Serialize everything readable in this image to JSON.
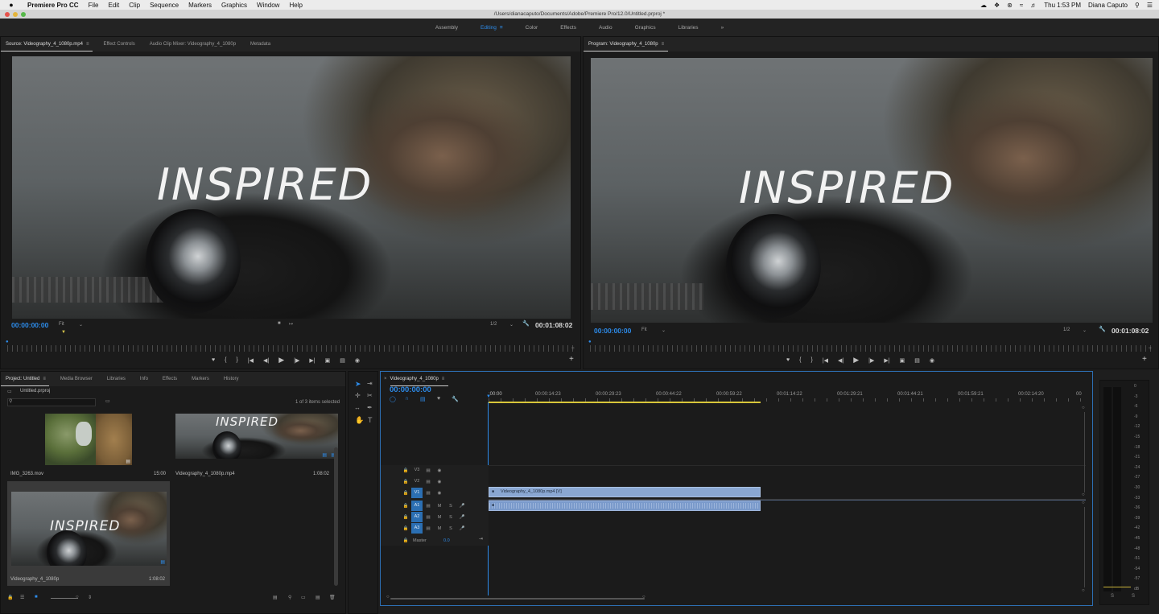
{
  "menubar": {
    "apple": "",
    "items": [
      "Premiere Pro CC",
      "File",
      "Edit",
      "Clip",
      "Sequence",
      "Markers",
      "Graphics",
      "Window",
      "Help"
    ],
    "clock": "Thu 1:53 PM",
    "user": "Diana Caputo"
  },
  "titlebar": {
    "path": "/Users/dianacaputo/Documents/Adobe/Premiere Pro/12.0/Untitled.prproj *"
  },
  "workspaces": {
    "items": [
      "Assembly",
      "Editing",
      "Color",
      "Effects",
      "Audio",
      "Graphics",
      "Libraries"
    ],
    "more": "»"
  },
  "source": {
    "tabs": [
      "Source: Videography_4_1080p.mp4",
      "Effect Controls",
      "Audio Clip Mixer: Videography_4_1080p",
      "Metadata"
    ],
    "overlay": "INSPIRED",
    "timecode": "00:00:00:00",
    "fit": "Fit",
    "resolution": "1/2",
    "duration": "00:01:08:02"
  },
  "program": {
    "tab": "Program: Videography_4_1080p",
    "overlay": "INSPIRED",
    "timecode": "00:00:00:00",
    "fit": "Fit",
    "resolution": "1/2",
    "duration": "00:01:08:02"
  },
  "project": {
    "tabs": [
      "Project: Untitled",
      "Media Browser",
      "Libraries",
      "Info",
      "Effects",
      "Markers",
      "History"
    ],
    "file": "Untitled.prproj",
    "selection": "1 of 3 items selected",
    "items": [
      {
        "name": "IMG_3263.mov",
        "duration": "15:00"
      },
      {
        "name": "Videography_4_1080p.mp4",
        "duration": "1:08:02",
        "overlay": "INSPIRED"
      },
      {
        "name": "Videography_4_1080p",
        "duration": "1:08:02",
        "overlay": "INSPIRED"
      }
    ]
  },
  "timeline": {
    "tab": "Videography_4_1080p",
    "timecode": "00:00:00:00",
    "ruler": [
      ":00:00",
      "00:00:14:23",
      "00:00:29:23",
      "00:00:44:22",
      "00:00:59:22",
      "00:01:14:22",
      "00:01:29:21",
      "00:01:44:21",
      "00:01:59:21",
      "00:02:14:20",
      "00"
    ],
    "video_tracks": [
      "V3",
      "V2",
      "V1"
    ],
    "audio_tracks": [
      "A1",
      "A2",
      "A3"
    ],
    "track_buttons": {
      "mute": "M",
      "solo": "S"
    },
    "master": {
      "label": "Master",
      "value": "0.0"
    },
    "clip_name": "Videography_4_1080p.mp4 [V]"
  },
  "meter": {
    "scale": [
      "0",
      "-3",
      "-6",
      "-9",
      "-12",
      "-15",
      "-18",
      "-21",
      "-24",
      "-27",
      "-30",
      "-33",
      "-36",
      "-39",
      "-42",
      "-45",
      "-48",
      "-51",
      "-54",
      "-57",
      "dB"
    ],
    "solo": [
      "S",
      "S"
    ]
  }
}
